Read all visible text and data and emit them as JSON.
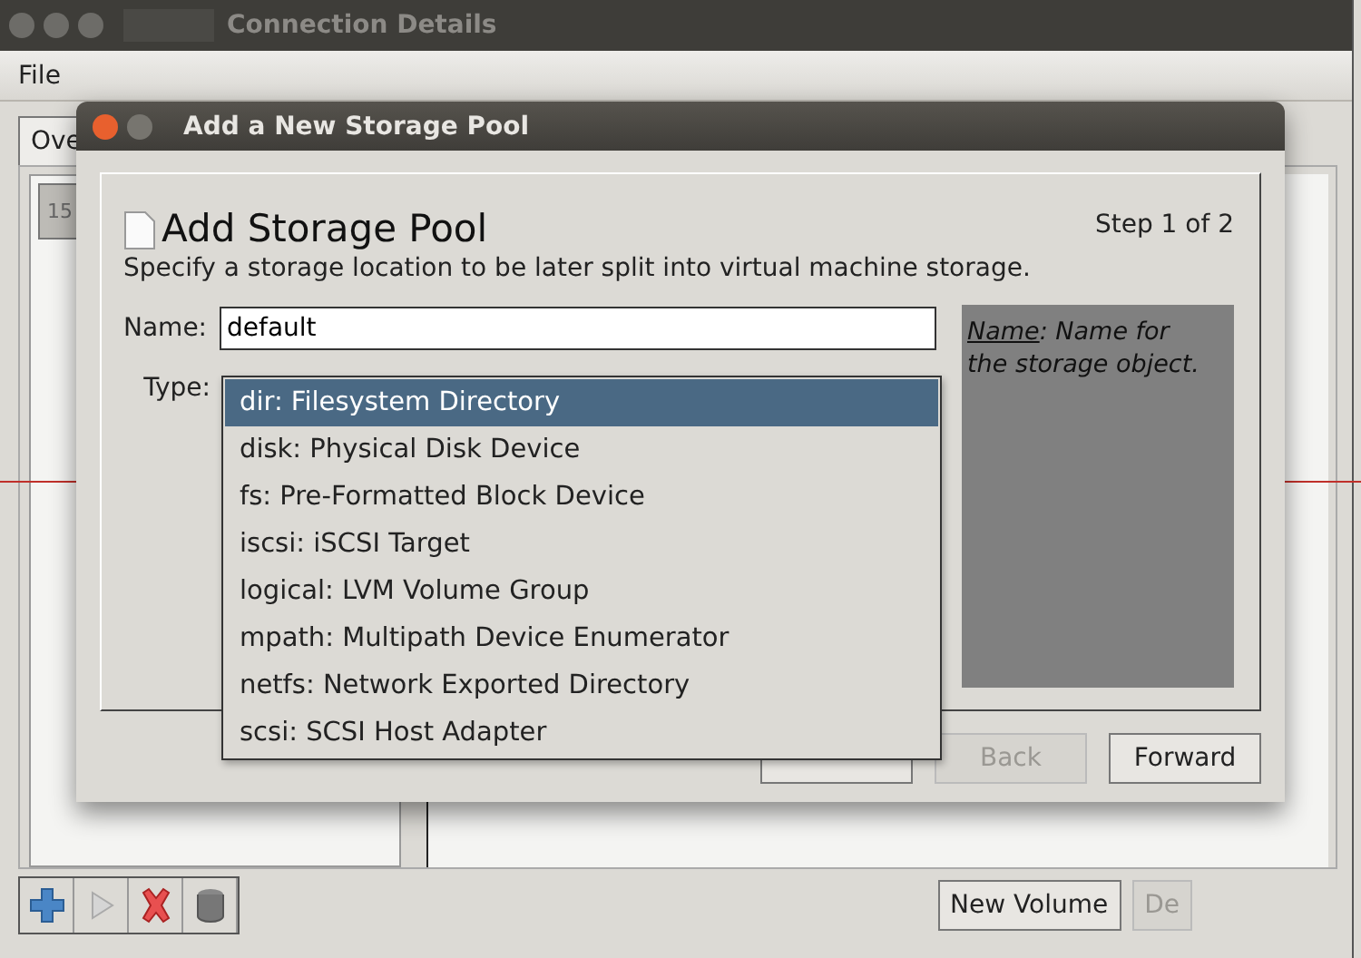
{
  "main_window": {
    "title": "Connection Details",
    "menu": [
      "File"
    ],
    "tab": {
      "label": "Ove",
      "selected": true
    },
    "pool_usage": "15",
    "buttons": [
      {
        "label": "New Volume",
        "disabled": false
      },
      {
        "label": "De",
        "disabled": true
      }
    ]
  },
  "dialog": {
    "title": "Add a New Storage Pool",
    "heading": "Add Storage Pool",
    "step": "Step 1 of 2",
    "subtitle": "Specify a storage location to be later split into virtual machine storage.",
    "name_label": "Name:",
    "name_value": "default",
    "type_label": "Type:",
    "help": {
      "term": "Name",
      "text": ": Name for the storage object."
    },
    "buttons": [
      {
        "disabled": false
      },
      {
        "label": "Back",
        "disabled": true
      },
      {
        "label": "Forward",
        "disabled": false
      }
    ]
  },
  "type_options": [
    {
      "label": "dir: Filesystem Directory",
      "selected": true
    },
    {
      "label": "disk: Physical Disk Device",
      "selected": false
    },
    {
      "label": "fs: Pre-Formatted Block Device",
      "selected": false
    },
    {
      "label": "iscsi: iSCSI Target",
      "selected": false
    },
    {
      "label": "logical: LVM Volume Group",
      "selected": false
    },
    {
      "label": "mpath: Multipath Device Enumerator",
      "selected": false
    },
    {
      "label": "netfs: Network Exported Directory",
      "selected": false
    },
    {
      "label": "scsi: SCSI Host Adapter",
      "selected": false
    }
  ]
}
